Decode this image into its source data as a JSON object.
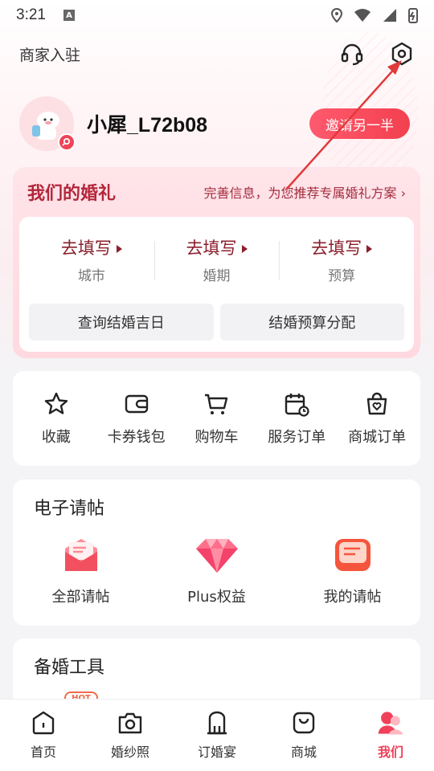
{
  "status_bar": {
    "time": "3:21",
    "notif": "A"
  },
  "header": {
    "merchant_label": "商家入驻"
  },
  "profile": {
    "username": "小犀_L72b08",
    "invite_label": "邀请另一半"
  },
  "wedding": {
    "title": "我们的婚礼",
    "hint": "完善信息，为您推荐专属婚礼方案 ›",
    "fields": [
      {
        "action": "去填写",
        "label": "城市"
      },
      {
        "action": "去填写",
        "label": "婚期"
      },
      {
        "action": "去填写",
        "label": "预算"
      }
    ],
    "tools": [
      "查询结婚吉日",
      "结婚预算分配"
    ]
  },
  "quick_actions": [
    {
      "label": "收藏",
      "icon": "star-icon"
    },
    {
      "label": "卡券钱包",
      "icon": "wallet-icon"
    },
    {
      "label": "购物车",
      "icon": "cart-icon"
    },
    {
      "label": "服务订单",
      "icon": "calendar-clock-icon"
    },
    {
      "label": "商城订单",
      "icon": "bag-heart-icon"
    }
  ],
  "invitations": {
    "title": "电子请帖",
    "items": [
      {
        "label": "全部请帖",
        "icon": "envelope-icon"
      },
      {
        "label": "Plus权益",
        "icon": "diamond-icon"
      },
      {
        "label": "我的请帖",
        "icon": "card-icon"
      }
    ]
  },
  "tools_section": {
    "title": "备婚工具",
    "tag": "HOT"
  },
  "bottom_nav": [
    {
      "label": "首页",
      "icon": "home-icon"
    },
    {
      "label": "婚纱照",
      "icon": "camera-icon"
    },
    {
      "label": "订婚宴",
      "icon": "venue-icon"
    },
    {
      "label": "商城",
      "icon": "shop-bag-icon"
    },
    {
      "label": "我们",
      "icon": "couple-icon",
      "active": true
    }
  ],
  "colors": {
    "accent": "#f0405a",
    "wedding_title": "#b3263a",
    "fill_action": "#8b1f2c",
    "arrow": "#e03a3a"
  }
}
